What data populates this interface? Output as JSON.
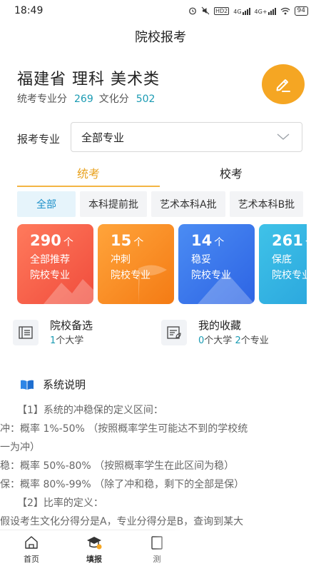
{
  "status_bar": {
    "time": "18:49",
    "icons": [
      "alarm-icon",
      "mute-icon",
      "hd-icon",
      "signal-4g-icon",
      "signal-4g-plus-icon",
      "wifi-icon"
    ],
    "hd_label": "HD2",
    "net1": "4G",
    "net2": "4G+",
    "battery": "94"
  },
  "header": {
    "title": "院校报考"
  },
  "profile": {
    "title": "福建省 理科 美术类",
    "major_score_label": "统考专业分",
    "major_score": "269",
    "culture_score_label": "文化分",
    "culture_score": "502",
    "edit_icon": "pencil-icon",
    "accent_color": "#f5a623"
  },
  "major_filter": {
    "label": "报考专业",
    "value": "全部专业"
  },
  "tabs": [
    {
      "label": "统考",
      "active": true
    },
    {
      "label": "校考",
      "active": false
    }
  ],
  "batch_chips": [
    {
      "label": "全部",
      "active": true
    },
    {
      "label": "本科提前批",
      "active": false
    },
    {
      "label": "艺术本科A批",
      "active": false
    },
    {
      "label": "艺术本科B批",
      "active": false
    }
  ],
  "cards": [
    {
      "count": "290",
      "unit": "个",
      "line1": "全部推荐",
      "line2": "院校专业",
      "color": "#f04c3c"
    },
    {
      "count": "15",
      "unit": "个",
      "line1": "冲刺",
      "line2": "院校专业",
      "color": "#f47b14"
    },
    {
      "count": "14",
      "unit": "个",
      "line1": "稳妥",
      "line2": "院校专业",
      "color": "#2d64e4"
    },
    {
      "count": "261",
      "unit": "个",
      "line1": "保底",
      "line2": "院校专业",
      "color": "#28a3dc"
    }
  ],
  "shortcuts": {
    "candidates": {
      "title": "院校备选",
      "count": "1",
      "unit": "个大学",
      "icon": "list-icon"
    },
    "favorites": {
      "title": "我的收藏",
      "univ_count": "0",
      "univ_unit": "个大学",
      "major_count": "2",
      "major_unit": "个专业",
      "icon": "favorite-doc-icon"
    }
  },
  "description": {
    "title": "系统说明",
    "icon": "book-icon",
    "lines": [
      "【1】系统的冲稳保的定义区间：",
      "冲：概率 1%-50% （按照概率学生可能达不到的学校统",
      "一为冲）",
      "稳：概率 50%-80% （按照概率学生在此区间为稳）",
      "保：概率 80%-99% （除了冲和稳，剩下的全部是保）",
      "【2】比率的定义：",
      "假设考生文化分得分是A，专业分得分是B，查询到某大"
    ]
  },
  "bottom_nav": [
    {
      "label": "首页",
      "icon": "home-icon",
      "active": false
    },
    {
      "label": "填报",
      "icon": "graduation-cap-icon",
      "active": true
    },
    {
      "label": "测",
      "icon": "test-icon",
      "active": false
    }
  ]
}
